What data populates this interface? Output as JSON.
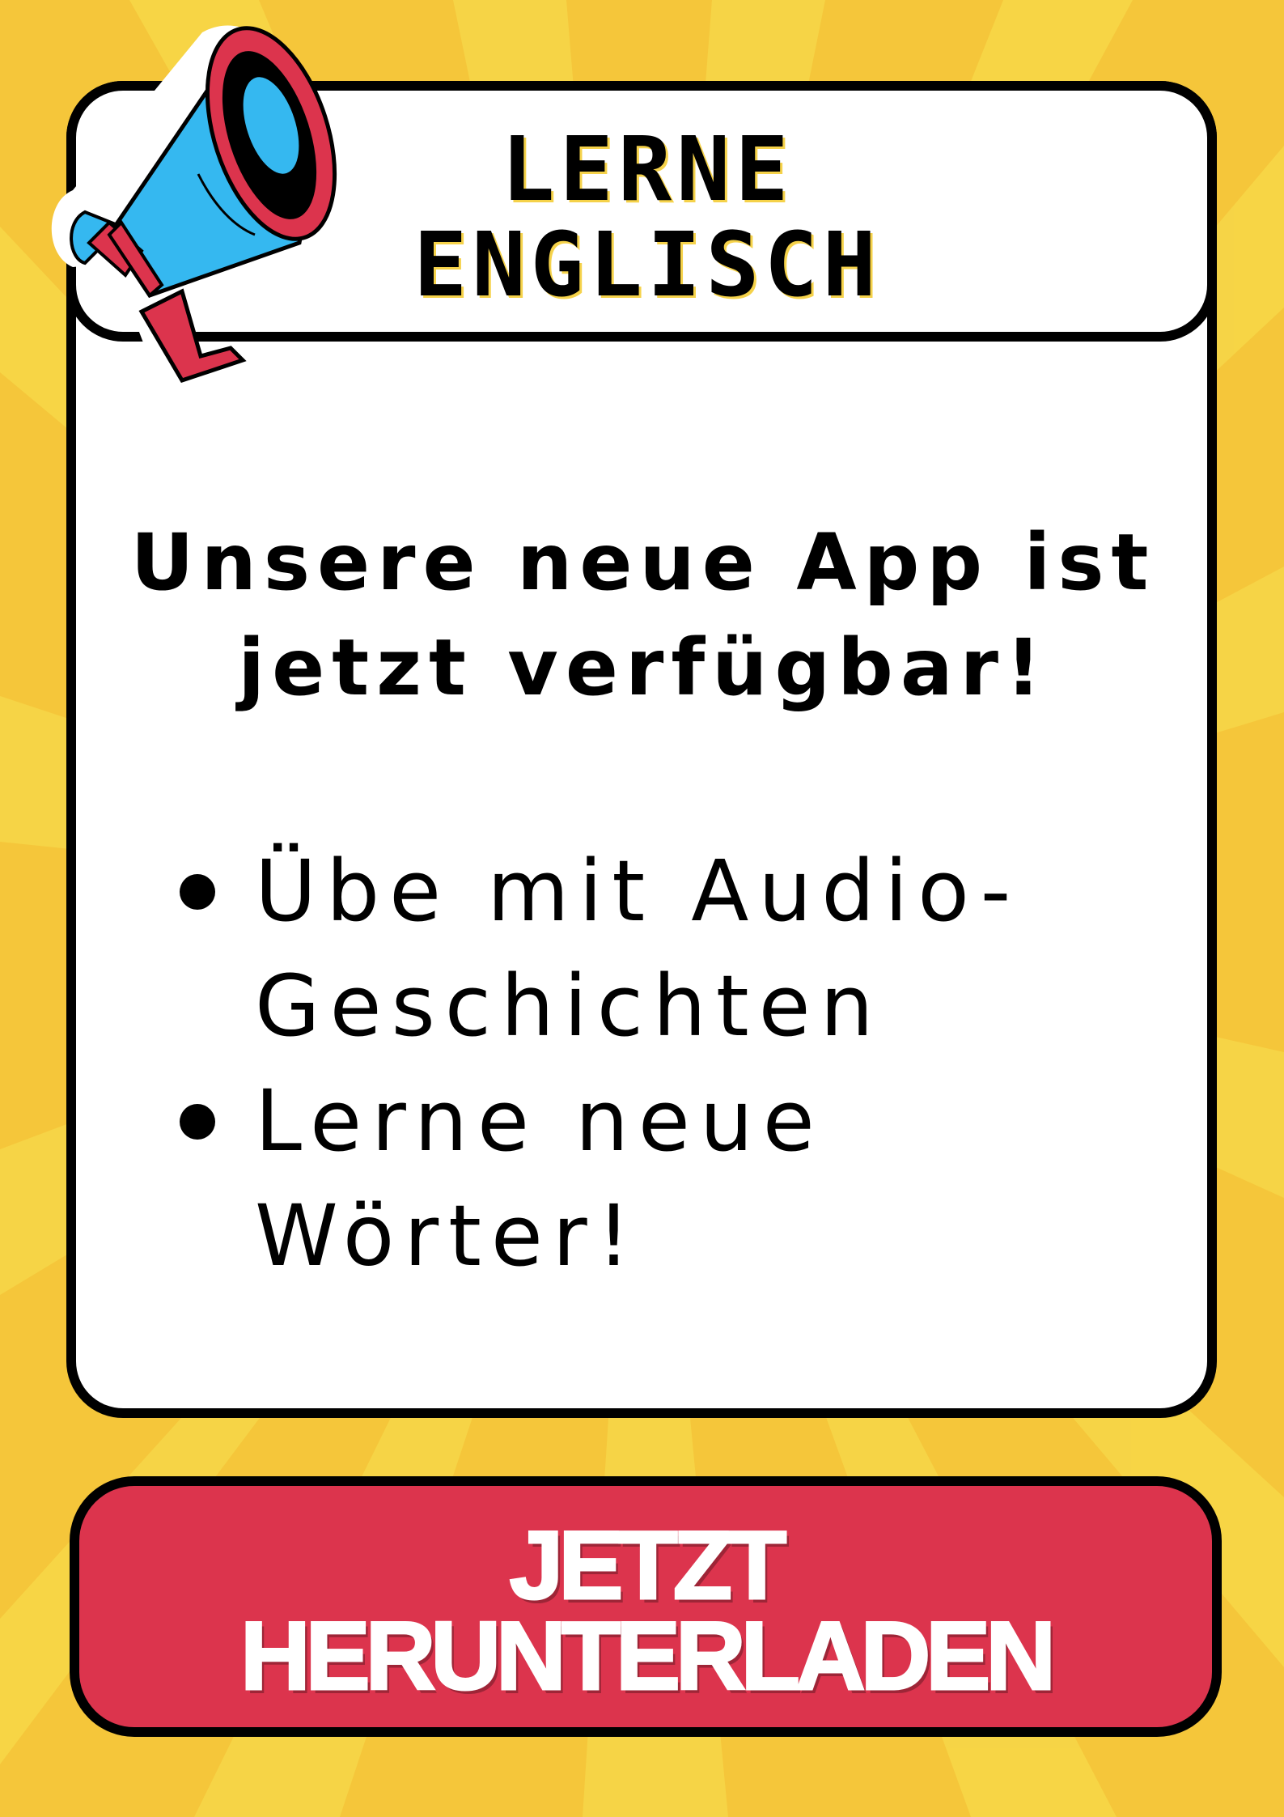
{
  "colors": {
    "background": "#f5c63a",
    "ray_light": "#f7d94a",
    "card": "#ffffff",
    "outline": "#000000",
    "cta": "#dc344d",
    "megaphone_blue": "#35b8f0",
    "megaphone_red": "#dc344d"
  },
  "header": {
    "title_line1": "LERNE",
    "title_line2": "ENGLISCH"
  },
  "main": {
    "headline_line1": "Unsere neue App ist",
    "headline_line2": "jetzt verfügbar!",
    "bullets": [
      {
        "line1": "Übe mit Audio-",
        "line2": "Geschichten"
      },
      {
        "line1": "Lerne neue",
        "line2": "Wörter!"
      }
    ]
  },
  "cta": {
    "line1": "JETZT",
    "line2": "HERUNTERLADEN"
  },
  "icons": {
    "megaphone": "megaphone-icon",
    "bullet": "bullet-dot-icon"
  }
}
